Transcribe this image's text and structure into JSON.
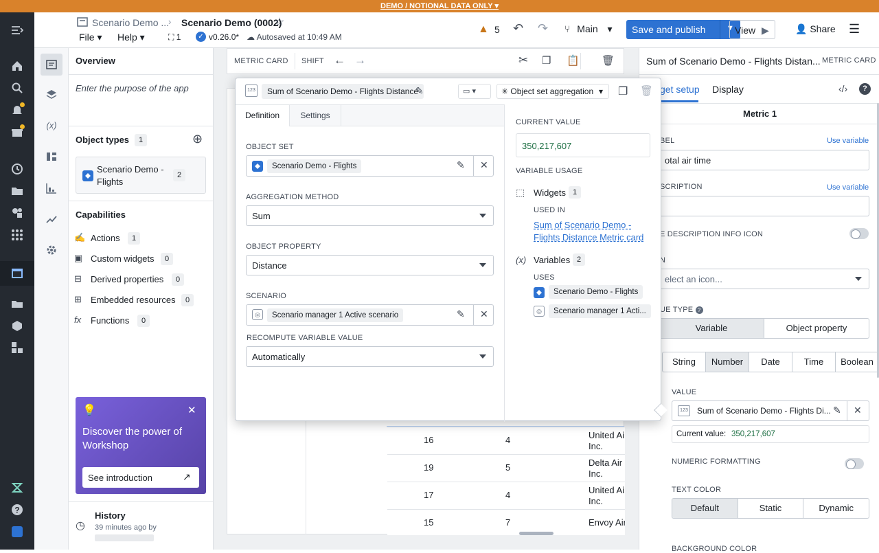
{
  "banner": "DEMO / NOTIONAL DATA ONLY",
  "header": {
    "breadcrumb_parent": "Scenario Demo ...",
    "title": "Scenario Demo (0002)",
    "menu_file": "File",
    "menu_help": "Help",
    "branch_count": "1",
    "version": "v0.26.0*",
    "autosave": "Autosaved at 10:49 AM",
    "warning_count": "5",
    "branch": "Main",
    "save_publish": "Save and publish",
    "view": "View",
    "share": "Share"
  },
  "overview": {
    "title": "Overview",
    "purpose_placeholder": "Enter the purpose of the app",
    "object_types_label": "Object types",
    "object_types_count": "1",
    "object_type_name": "Scenario Demo - Flights",
    "object_type_count": "2",
    "capabilities_label": "Capabilities",
    "capabilities": [
      {
        "label": "Actions",
        "count": "1"
      },
      {
        "label": "Custom widgets",
        "count": "0"
      },
      {
        "label": "Derived properties",
        "count": "0"
      },
      {
        "label": "Embedded resources",
        "count": "0"
      },
      {
        "label": "Functions",
        "count": "0"
      }
    ],
    "promo_title": "Discover the power of Workshop",
    "promo_button": "See introduction",
    "history_label": "History",
    "history_time": "39 minutes ago by"
  },
  "toolbar": {
    "metric_card": "METRIC CARD",
    "shift": "SHIFT"
  },
  "popover": {
    "variable_name": "Sum of Scenario Demo - Flights Distance",
    "type_dropdown": "Object set aggregation",
    "tab_definition": "Definition",
    "tab_settings": "Settings",
    "object_set_label": "OBJECT SET",
    "object_set_value": "Scenario Demo - Flights",
    "aggregation_label": "AGGREGATION METHOD",
    "aggregation_value": "Sum",
    "property_label": "OBJECT PROPERTY",
    "property_value": "Distance",
    "scenario_label": "SCENARIO",
    "scenario_value": "Scenario manager 1 Active scenario",
    "recompute_label": "RECOMPUTE VARIABLE VALUE",
    "recompute_value": "Automatically",
    "current_value_label": "CURRENT VALUE",
    "current_value": "350,217,607",
    "usage_label": "VARIABLE USAGE",
    "widgets_label": "Widgets",
    "widgets_count": "1",
    "used_in_label": "USED IN",
    "used_in_link": "Sum of Scenario Demo - Flights Distance Metric card",
    "variables_label": "Variables",
    "variables_count": "2",
    "uses_label": "USES",
    "uses_1": "Scenario Demo - Flights",
    "uses_2": "Scenario manager 1 Acti..."
  },
  "table": {
    "rows": [
      {
        "a": "16",
        "b": "4",
        "c": "United Ai Inc."
      },
      {
        "a": "19",
        "b": "5",
        "c": "Delta Air Inc."
      },
      {
        "a": "17",
        "b": "4",
        "c": "United Ai Inc."
      },
      {
        "a": "15",
        "b": "7",
        "c": "Envoy Air"
      }
    ]
  },
  "right_panel": {
    "title": "Sum of Scenario Demo - Flights Distan...",
    "type": "METRIC CARD",
    "tab_setup": "get setup",
    "tab_display": "Display",
    "section": "Metric 1",
    "label_label": "BEL",
    "use_variable": "Use variable",
    "label_value": "otal air time",
    "description_label": "SCRIPTION",
    "hide_desc": "E DESCRIPTION INFO ICON",
    "icon_label": "N",
    "icon_placeholder": "elect an icon...",
    "value_type_label": "UE TYPE",
    "vt_variable": "Variable",
    "vt_property": "Object property",
    "types": [
      "String",
      "Number",
      "Date",
      "Time",
      "Boolean"
    ],
    "value_label": "VALUE",
    "value_var": "Sum of Scenario Demo - Flights Di...",
    "current_label": "Current value:",
    "current_value": "350,217,607",
    "numeric_formatting": "NUMERIC FORMATTING",
    "text_color": "TEXT COLOR",
    "tc": [
      "Default",
      "Static",
      "Dynamic"
    ],
    "bg_color": "BACKGROUND COLOR"
  }
}
